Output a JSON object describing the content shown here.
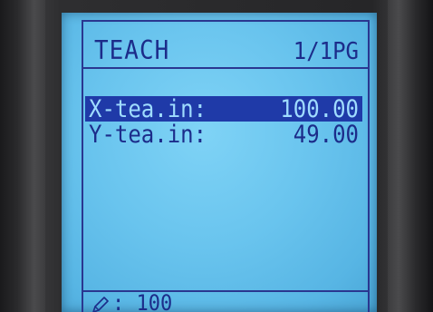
{
  "screen": {
    "title": "TEACH",
    "page_indicator": "1/1PG"
  },
  "params": [
    {
      "label": "X-tea.in:",
      "value": "100.00",
      "selected": true
    },
    {
      "label": "Y-tea.in:",
      "value": "49.00",
      "selected": false
    }
  ],
  "footer": {
    "icon": "pencil-icon",
    "separator": ":",
    "value": "100"
  },
  "colors": {
    "lcd_background": "#69c4ee",
    "text": "#1c2c8a",
    "selection_background": "#1f3aa8",
    "selection_text": "#9fdcff"
  }
}
